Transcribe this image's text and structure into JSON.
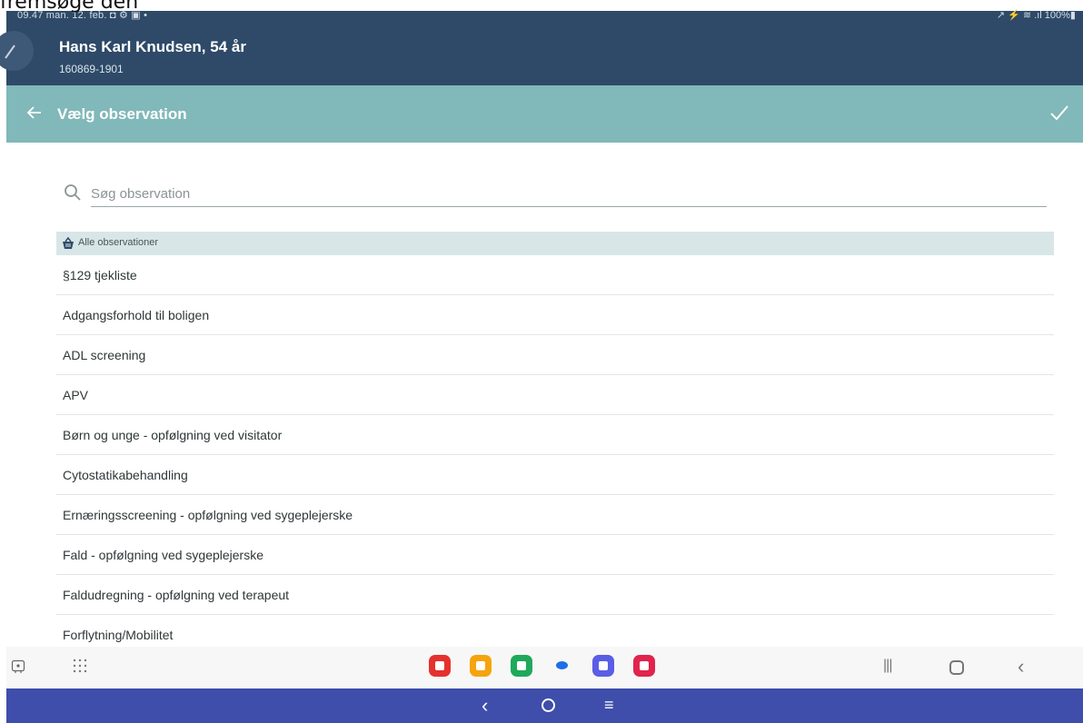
{
  "caption": "fremsøge den",
  "status_bar": {
    "left": "09.47  man. 12. feb.  ◘ ⚙ ▣ •",
    "right": "↗ ⚡ ≋ .ıl 100%▮"
  },
  "patient": {
    "name": "Hans Karl Knudsen, 54 år",
    "id": "160869-1901"
  },
  "title_bar": {
    "title": "Vælg observation",
    "back_icon": "arrow-left-icon",
    "confirm_icon": "check-icon"
  },
  "search": {
    "placeholder": "Søg observation",
    "value": ""
  },
  "group": {
    "label": "Alle observationer",
    "icon": "basket-icon"
  },
  "observations": [
    "§129 tjekliste",
    "Adgangsforhold til boligen",
    "ADL screening",
    "APV",
    "Børn og unge - opfølgning ved visitator",
    "Cytostatikabehandling",
    "Ernæringsscreening - opfølgning ved sygeplejerske",
    "Fald - opfølgning ved sygeplejerske",
    "Faldudregning - opfølgning ved terapeut",
    "Forflytning/Mobilitet"
  ],
  "nav_bar": {
    "apps": [
      {
        "name": "app-red",
        "color": "#e5312d"
      },
      {
        "name": "app-orange",
        "color": "#f5a40e"
      },
      {
        "name": "app-green",
        "color": "#1fa95d"
      },
      {
        "name": "app-messages",
        "color": "#1d6ee8"
      },
      {
        "name": "app-purple",
        "color": "#5a5ee5"
      },
      {
        "name": "app-pink",
        "color": "#e0244d"
      }
    ]
  },
  "colors": {
    "header": "#2e4a68",
    "title_bar": "#81b8b9",
    "group_bg": "#d8e6e7",
    "bottom_bar": "#3e4eaa"
  }
}
